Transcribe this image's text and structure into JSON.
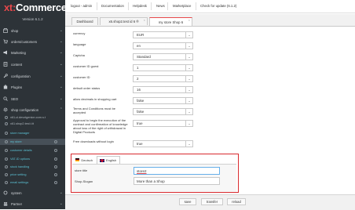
{
  "app": {
    "brand_pre": "xt:",
    "brand_post": "Commerce",
    "version": "Version 6.1.2"
  },
  "sidebar": {
    "items": [
      {
        "label": "shop",
        "icon": "shop-icon"
      },
      {
        "label": "orders/customers",
        "icon": "cart-icon"
      },
      {
        "label": "Marketing",
        "icon": "megaphone-icon"
      },
      {
        "label": "content",
        "icon": "content-icon"
      },
      {
        "label": "configuration",
        "icon": "wrench-icon"
      },
      {
        "label": "Plugins",
        "icon": "plugin-icon"
      },
      {
        "label": "SEO",
        "icon": "seo-icon"
      },
      {
        "label": "shop configuration",
        "icon": "gear-icon"
      }
    ],
    "sub_items": [
      {
        "label": "x61-ci.devxtgenion.com.s.t"
      },
      {
        "label": "x61.shop2.test.t.tt"
      },
      {
        "label": "store manager"
      },
      {
        "label": "my store"
      },
      {
        "label": "customer details"
      },
      {
        "label": "VAT-ID options"
      },
      {
        "label": "stock handling"
      },
      {
        "label": "price setting"
      },
      {
        "label": "email settings"
      }
    ],
    "bottom": [
      {
        "label": "system",
        "icon": "system-icon"
      },
      {
        "label": "Partner",
        "icon": "partner-icon"
      }
    ]
  },
  "topbar": {
    "links": [
      "logout - admin",
      "Documentation",
      "Helpdesk",
      "News",
      "Marketplace",
      "Check for update (6.1.2)"
    ]
  },
  "tabs": [
    "Dashboard",
    "x6.shop2.test id 6 ®",
    "my store Shop 6"
  ],
  "form": {
    "rows": [
      {
        "label": "currency",
        "value": "EUR"
      },
      {
        "label": "language",
        "value": "en"
      },
      {
        "label": "Captcha",
        "value": "Standard"
      },
      {
        "label": "customer ID guest",
        "value": "1"
      },
      {
        "label": "customer ID",
        "value": "2"
      },
      {
        "label": "default order status",
        "value": "16"
      },
      {
        "label": "allow decimals in shopping cart",
        "value": "false"
      },
      {
        "label": "Terms and Conditions must be accepted",
        "value": "false"
      },
      {
        "label": "Approval to begin the execution of the contract and confirmation of knowledge about loss of the right of withdrawal in Digital Products",
        "value": "true"
      },
      {
        "label": "Free downloads without login",
        "value": "true"
      }
    ]
  },
  "language_section": {
    "tabs": [
      "Deutsch",
      "English"
    ],
    "store_title_label": "store title",
    "store_title_value": "store2",
    "shop_slogan_label": "Shop-Slogan",
    "shop_slogan_value": "More than a Shop"
  },
  "footer": {
    "buttons": [
      "save",
      "transfer",
      "reload"
    ]
  },
  "colors": {
    "accent": "#e8484b",
    "sidebar_bg": "#2d3338",
    "highlight_border": "#d9292e",
    "focus_border": "#66afe9"
  }
}
